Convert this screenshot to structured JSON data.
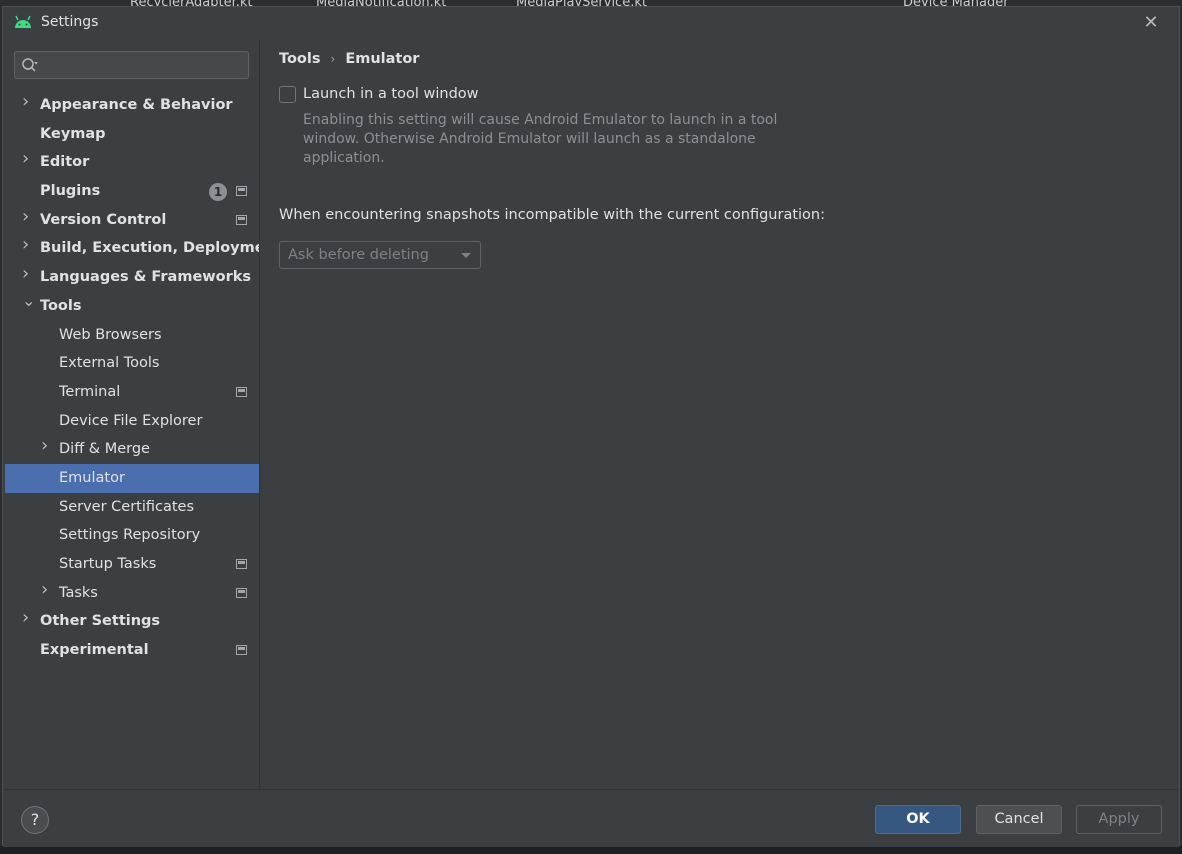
{
  "ide_tabs": [
    {
      "label": "RecyclerAdapter.kt"
    },
    {
      "label": "MediaNotification.kt"
    },
    {
      "label": "MediaPlayService.kt"
    },
    {
      "label": "Device Manager"
    }
  ],
  "dialog": {
    "title": "Settings",
    "close_icon": "close-icon"
  },
  "sidebar": {
    "search": {
      "value": "",
      "placeholder": ""
    },
    "items": [
      {
        "label": "Appearance & Behavior",
        "level": 0,
        "expandable": true,
        "expanded": false
      },
      {
        "label": "Keymap",
        "level": 0,
        "expandable": false
      },
      {
        "label": "Editor",
        "level": 0,
        "expandable": true,
        "expanded": false
      },
      {
        "label": "Plugins",
        "level": 0,
        "expandable": false,
        "badge": "1",
        "project_icon": true
      },
      {
        "label": "Version Control",
        "level": 0,
        "expandable": true,
        "expanded": false,
        "project_icon": true
      },
      {
        "label": "Build, Execution, Deployment",
        "level": 0,
        "expandable": true,
        "expanded": false
      },
      {
        "label": "Languages & Frameworks",
        "level": 0,
        "expandable": true,
        "expanded": false
      },
      {
        "label": "Tools",
        "level": 0,
        "expandable": true,
        "expanded": true
      },
      {
        "label": "Web Browsers",
        "level": 1,
        "expandable": false
      },
      {
        "label": "External Tools",
        "level": 1,
        "expandable": false
      },
      {
        "label": "Terminal",
        "level": 1,
        "expandable": false,
        "project_icon": true
      },
      {
        "label": "Device File Explorer",
        "level": 1,
        "expandable": false
      },
      {
        "label": "Diff & Merge",
        "level": 1,
        "expandable": true,
        "expanded": false
      },
      {
        "label": "Emulator",
        "level": 1,
        "expandable": false,
        "selected": true
      },
      {
        "label": "Server Certificates",
        "level": 1,
        "expandable": false
      },
      {
        "label": "Settings Repository",
        "level": 1,
        "expandable": false
      },
      {
        "label": "Startup Tasks",
        "level": 1,
        "expandable": false,
        "project_icon": true
      },
      {
        "label": "Tasks",
        "level": 1,
        "expandable": true,
        "expanded": false,
        "project_icon": true
      },
      {
        "label": "Other Settings",
        "level": 0,
        "expandable": true,
        "expanded": false
      },
      {
        "label": "Experimental",
        "level": 0,
        "expandable": false,
        "project_icon": true
      }
    ]
  },
  "content": {
    "breadcrumb": {
      "parent": "Tools",
      "current": "Emulator"
    },
    "launch_checkbox": {
      "label": "Launch in a tool window",
      "checked": false,
      "hint": "Enabling this setting will cause Android Emulator to launch in a tool window. Otherwise Android Emulator will launch as a standalone application."
    },
    "snapshot": {
      "label": "When encountering snapshots incompatible with the current configuration:",
      "selected": "Ask before deleting"
    }
  },
  "footer": {
    "help_label": "?",
    "ok_label": "OK",
    "cancel_label": "Cancel",
    "apply_label": "Apply"
  },
  "colors": {
    "dialog_bg": "#3c3f41",
    "selection": "#4b6eaf",
    "primary_button": "#365880",
    "android_green": "#3ddc84"
  }
}
